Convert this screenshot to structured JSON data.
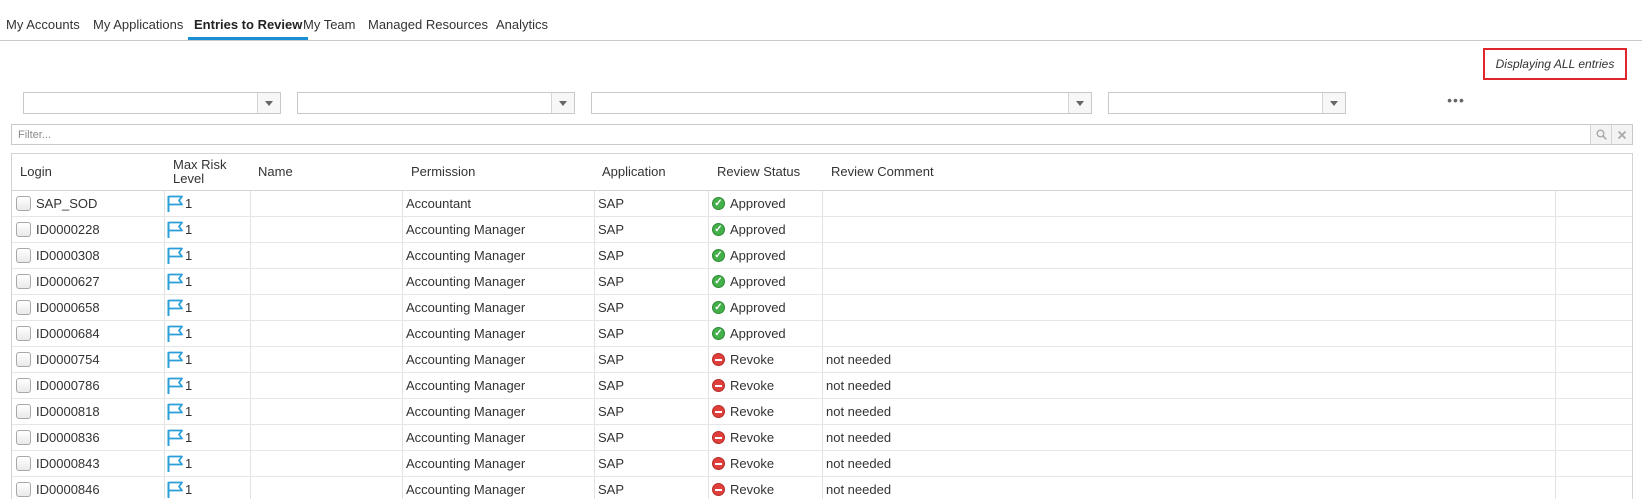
{
  "tabs": [
    {
      "label": "My Accounts",
      "active": false
    },
    {
      "label": "My Applications",
      "active": false
    },
    {
      "label": "Entries to Review",
      "active": true
    },
    {
      "label": "My Team",
      "active": false
    },
    {
      "label": "Managed Resources",
      "active": false
    },
    {
      "label": "Analytics",
      "active": false
    }
  ],
  "display_notice": "Displaying ALL entries",
  "filters": {
    "combo_values": [
      "",
      "",
      "",
      ""
    ],
    "more_label": "•••",
    "filter_placeholder": "Filter...",
    "search_icon": "search-icon",
    "clear_icon": "clear-icon"
  },
  "grid": {
    "columns": [
      "Login",
      "Max Risk Level",
      "Name",
      "Permission",
      "Application",
      "Review Status",
      "Review Comment"
    ],
    "rows": [
      {
        "login": "SAP_SOD",
        "risk": "1",
        "name": "",
        "permission": "Accountant",
        "application": "SAP",
        "status": "Approved",
        "comment": ""
      },
      {
        "login": "ID0000228",
        "risk": "1",
        "name": "",
        "permission": "Accounting Manager",
        "application": "SAP",
        "status": "Approved",
        "comment": ""
      },
      {
        "login": "ID0000308",
        "risk": "1",
        "name": "",
        "permission": "Accounting Manager",
        "application": "SAP",
        "status": "Approved",
        "comment": ""
      },
      {
        "login": "ID0000627",
        "risk": "1",
        "name": "",
        "permission": "Accounting Manager",
        "application": "SAP",
        "status": "Approved",
        "comment": ""
      },
      {
        "login": "ID0000658",
        "risk": "1",
        "name": "",
        "permission": "Accounting Manager",
        "application": "SAP",
        "status": "Approved",
        "comment": ""
      },
      {
        "login": "ID0000684",
        "risk": "1",
        "name": "",
        "permission": "Accounting Manager",
        "application": "SAP",
        "status": "Approved",
        "comment": ""
      },
      {
        "login": "ID0000754",
        "risk": "1",
        "name": "",
        "permission": "Accounting Manager",
        "application": "SAP",
        "status": "Revoke",
        "comment": "not needed"
      },
      {
        "login": "ID0000786",
        "risk": "1",
        "name": "",
        "permission": "Accounting Manager",
        "application": "SAP",
        "status": "Revoke",
        "comment": "not needed"
      },
      {
        "login": "ID0000818",
        "risk": "1",
        "name": "",
        "permission": "Accounting Manager",
        "application": "SAP",
        "status": "Revoke",
        "comment": "not needed"
      },
      {
        "login": "ID0000836",
        "risk": "1",
        "name": "",
        "permission": "Accounting Manager",
        "application": "SAP",
        "status": "Revoke",
        "comment": "not needed"
      },
      {
        "login": "ID0000843",
        "risk": "1",
        "name": "",
        "permission": "Accounting Manager",
        "application": "SAP",
        "status": "Revoke",
        "comment": "not needed"
      },
      {
        "login": "ID0000846",
        "risk": "1",
        "name": "",
        "permission": "Accounting Manager",
        "application": "SAP",
        "status": "Revoke",
        "comment": "not needed"
      }
    ]
  },
  "colors": {
    "active_tab_underline": "#1a8fd6",
    "notice_border": "#e0262a",
    "flag": "#2a9fd8",
    "approved": "#43b04a",
    "revoke": "#e0403b"
  }
}
